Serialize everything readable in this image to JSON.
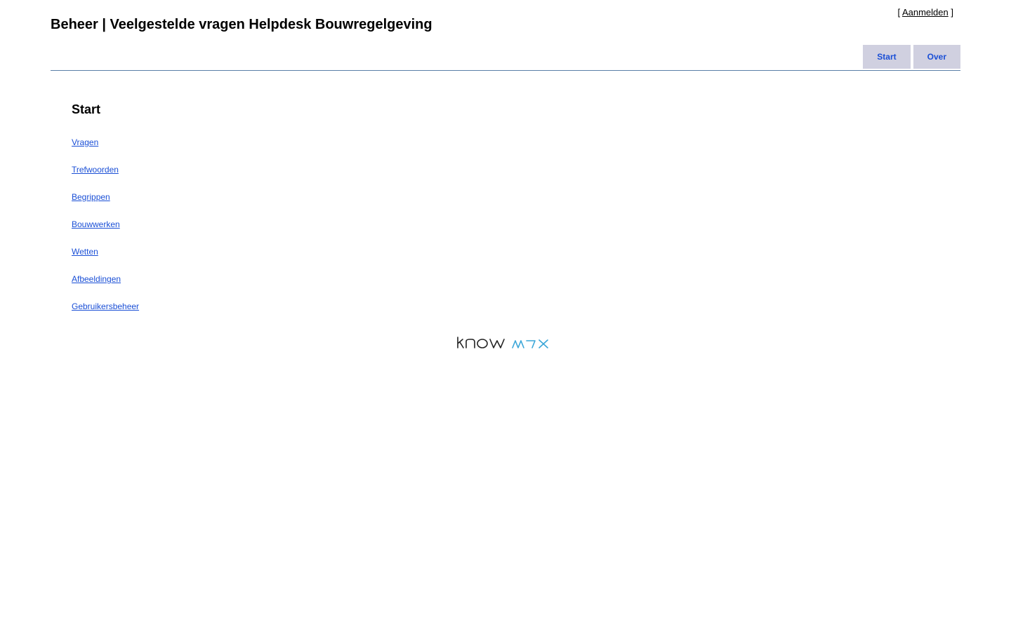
{
  "header": {
    "title": "Beheer | Veelgestelde vragen Helpdesk Bouwregelgeving",
    "login_open": "[",
    "login_label": "Aanmelden",
    "login_close": "]"
  },
  "tabs": [
    {
      "label": "Start"
    },
    {
      "label": "Over"
    }
  ],
  "main": {
    "heading": "Start",
    "links": [
      {
        "label": "Vragen"
      },
      {
        "label": "Trefwoorden"
      },
      {
        "label": "Begrippen"
      },
      {
        "label": "Bouwwerken"
      },
      {
        "label": "Wetten"
      },
      {
        "label": "Afbeeldingen"
      },
      {
        "label": "Gebruikersbeheer"
      }
    ]
  },
  "footer": {
    "logo_text": "knowmax",
    "colors": {
      "know": "#222222",
      "max": "#3aa6d8"
    }
  },
  "colors": {
    "link": "#1a4fd6",
    "tab_bg": "#d0d0e0",
    "rule": "#5a7fa8"
  }
}
